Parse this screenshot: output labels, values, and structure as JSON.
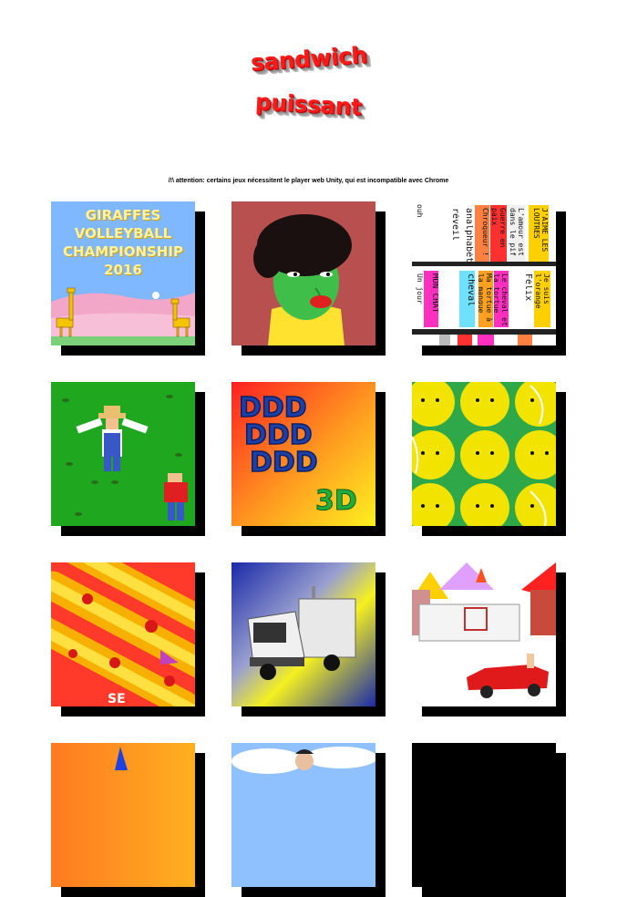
{
  "logo": {
    "line1": "sandwich",
    "line2": "puissant"
  },
  "warning": "/!\\ attention: certains jeux nécessitent le player web Unity, qui est incompatible avec Chrome",
  "colors": {
    "logo_red": "#ff1a1a",
    "shadow": "#000000",
    "background": "#ffffff"
  },
  "games": {
    "giraffes": {
      "title": "GIRAFFES VOLLEYBALL CHAMPIONSHIP 2016"
    },
    "shelf": {
      "top": [
        "ouh",
        "réveil",
        "analphabète",
        "Chroqueur !",
        "Guerre en paix",
        "L'amour est dans le pif",
        "J'AIME LES LOUTRES"
      ],
      "bottom": [
        "Un jour",
        "MON CHAT",
        "cheval",
        "Ma tortue à la mangue",
        "Le cheval et la tortue",
        "Félix",
        "Je suis l'orange"
      ]
    },
    "pizza": {
      "text": "SE"
    }
  }
}
